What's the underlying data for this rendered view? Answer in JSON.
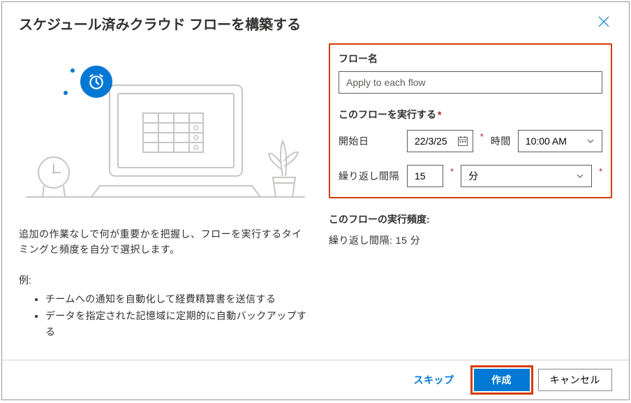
{
  "dialog": {
    "title": "スケジュール済みクラウド フローを構築する",
    "close_aria": "閉じる"
  },
  "left": {
    "description": "追加の作業なしで何が重要かを把握し、フローを実行するタイミングと頻度を自分で選択します。",
    "examples_label": "例:",
    "examples": [
      "チームへの通知を自動化して経費精算書を送信する",
      "データを指定された記憶域に定期的に自動バックアップする"
    ]
  },
  "form": {
    "flow_name_label": "フロー名",
    "flow_name_value": "Apply to each flow",
    "run_section_label": "このフローを実行する",
    "start_date_label": "開始日",
    "start_date_value": "22/3/25",
    "time_label": "時間",
    "time_value": "10:00 AM",
    "repeat_label": "繰り返し間隔",
    "repeat_value": "15",
    "unit_value": "分"
  },
  "frequency": {
    "title": "このフローの実行頻度:",
    "text": "繰り返し間隔: 15 分"
  },
  "footer": {
    "skip": "スキップ",
    "create": "作成",
    "cancel": "キャンセル"
  }
}
